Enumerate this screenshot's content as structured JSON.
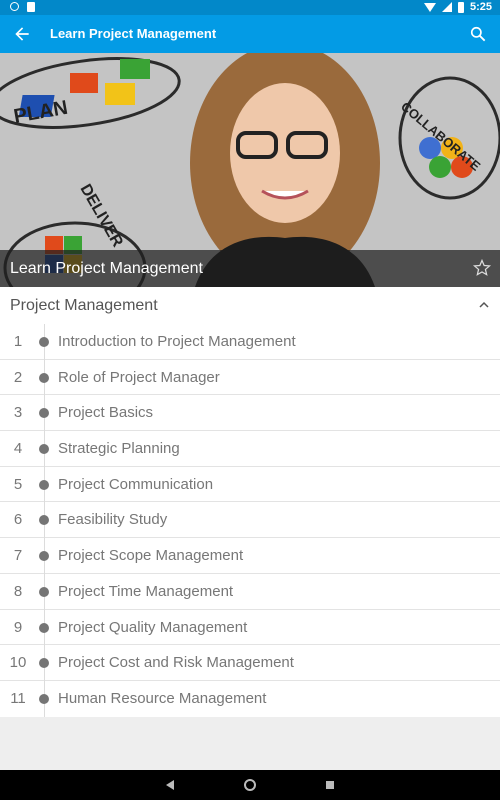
{
  "status_bar": {
    "time": "5:25"
  },
  "app_bar": {
    "title": "Learn Project Management"
  },
  "hero": {
    "caption": "Learn Project Management",
    "art_words": {
      "plan": "PLAN",
      "collaborate": "COLLABORATE",
      "deliver": "DELIVER"
    }
  },
  "section": {
    "title": "Project Management",
    "lessons": [
      {
        "num": "1",
        "title": "Introduction to Project Management"
      },
      {
        "num": "2",
        "title": "Role of Project Manager"
      },
      {
        "num": "3",
        "title": "Project Basics"
      },
      {
        "num": "4",
        "title": "Strategic Planning"
      },
      {
        "num": "5",
        "title": "Project Communication"
      },
      {
        "num": "6",
        "title": "Feasibility Study"
      },
      {
        "num": "7",
        "title": "Project Scope Management"
      },
      {
        "num": "8",
        "title": "Project Time Management"
      },
      {
        "num": "9",
        "title": "Project Quality Management"
      },
      {
        "num": "10",
        "title": "Project Cost and Risk Management"
      },
      {
        "num": "11",
        "title": "Human Resource Management"
      }
    ]
  },
  "colors": {
    "primary": "#039be5",
    "primary_dark": "#0288c9"
  },
  "icons": {
    "back": "arrow-left-icon",
    "search": "search-icon",
    "favorite": "star-outline-icon",
    "collapse": "chevron-up-icon",
    "nav_back": "triangle-back-icon",
    "nav_home": "circle-home-icon",
    "nav_recents": "square-recents-icon"
  }
}
